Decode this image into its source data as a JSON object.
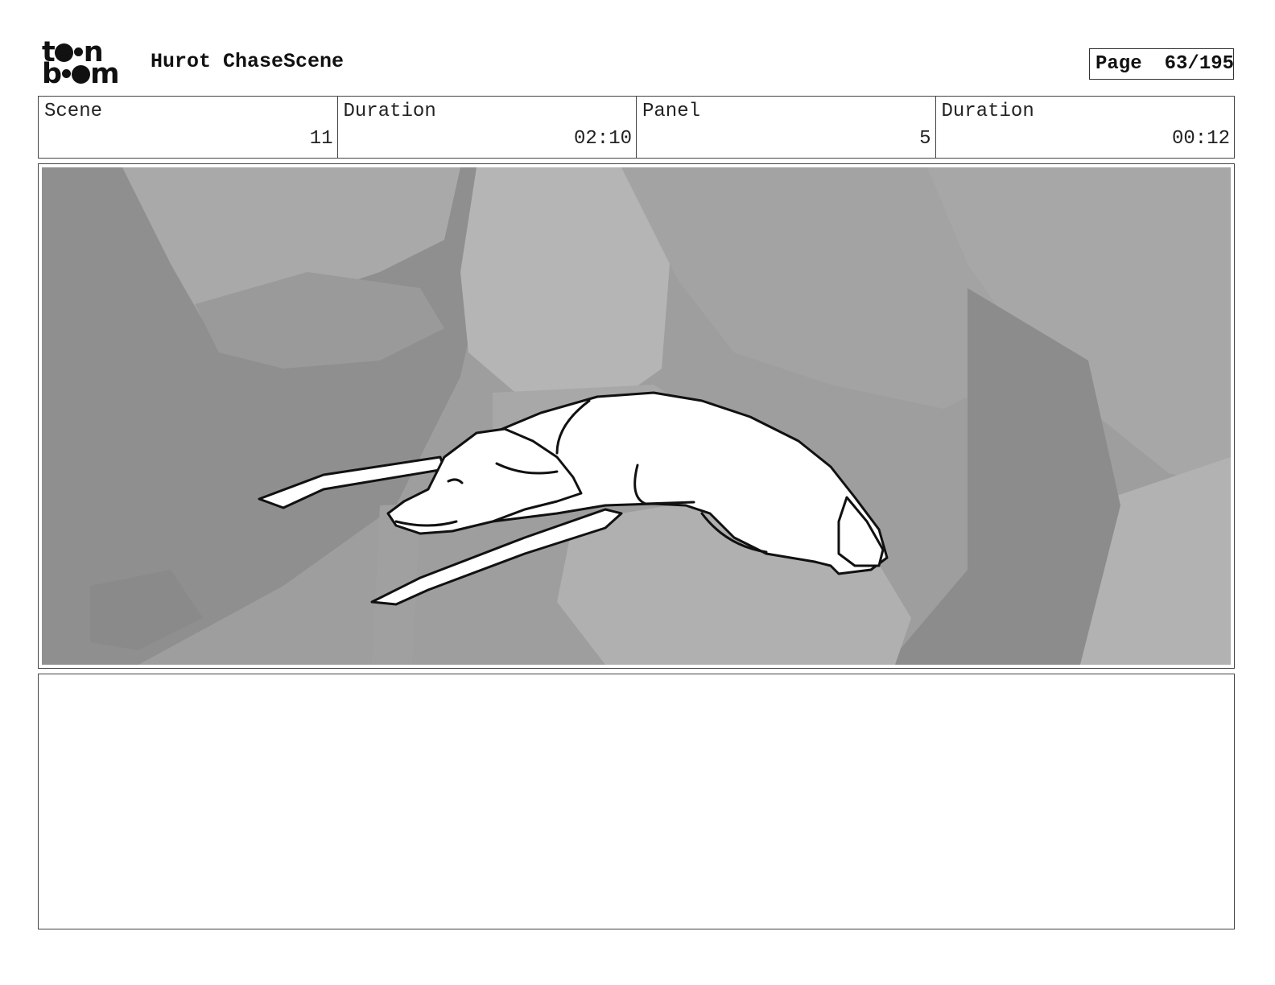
{
  "header": {
    "logo": {
      "line1": "toon",
      "line2": "boom"
    },
    "title": "Hurot ChaseScene",
    "page_label": "Page",
    "page_value": "63/195"
  },
  "info": [
    {
      "label": "Scene",
      "value": "11"
    },
    {
      "label": "Duration",
      "value": "02:10"
    },
    {
      "label": "Panel",
      "value": "5"
    },
    {
      "label": "Duration",
      "value": "00:12"
    }
  ],
  "panel": {
    "image": "storyboard-sketch-lying-dog",
    "colors": {
      "background": "#9e9e9e",
      "figure": "#ffffff",
      "ink": "#111111"
    }
  },
  "notes": {}
}
